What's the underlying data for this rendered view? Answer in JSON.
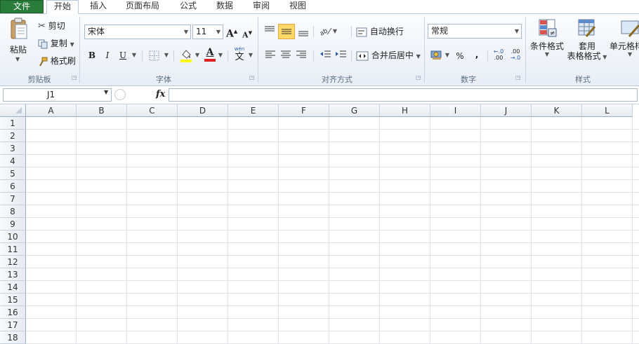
{
  "menu": {
    "tabs": [
      {
        "label": "文件"
      },
      {
        "label": "开始"
      },
      {
        "label": "插入"
      },
      {
        "label": "页面布局"
      },
      {
        "label": "公式"
      },
      {
        "label": "数据"
      },
      {
        "label": "审阅"
      },
      {
        "label": "视图"
      }
    ]
  },
  "clipboard": {
    "paste_label": "粘贴",
    "cut_label": "剪切",
    "copy_label": "复制",
    "format_painter_label": "格式刷",
    "group_label": "剪贴板"
  },
  "font": {
    "font_name": "宋体",
    "font_size": "11",
    "bold": "B",
    "italic": "I",
    "underline": "U",
    "font_color_letter": "A",
    "grow_letter": "A",
    "shrink_letter": "A",
    "wen_label": "wén",
    "wen_char": "文",
    "group_label": "字体",
    "font_color": "#e02020",
    "fill_color": "#ffff00"
  },
  "alignment": {
    "wrap_text_label": "自动换行",
    "merge_center_label": "合并后居中",
    "group_label": "对齐方式"
  },
  "number": {
    "format": "常规",
    "percent": "%",
    "comma": ",",
    "inc_decimal": ".00",
    "dec_decimal": ".0",
    "group_label": "数字"
  },
  "styles": {
    "conditional_format_label": "条件格式",
    "table_format_label_1": "套用",
    "table_format_label_2": "表格格式",
    "cell_styles_label": "单元格样式",
    "group_label": "样式"
  },
  "formula_bar": {
    "name_box": "J1",
    "fx": "fx",
    "formula": ""
  },
  "grid": {
    "columns": [
      "A",
      "B",
      "C",
      "D",
      "E",
      "F",
      "G",
      "H",
      "I",
      "J",
      "K",
      "L"
    ],
    "rows": [
      "1",
      "2",
      "3",
      "4",
      "5",
      "6",
      "7",
      "8",
      "9",
      "10",
      "11",
      "12",
      "13",
      "14",
      "15",
      "16",
      "17",
      "18"
    ]
  }
}
